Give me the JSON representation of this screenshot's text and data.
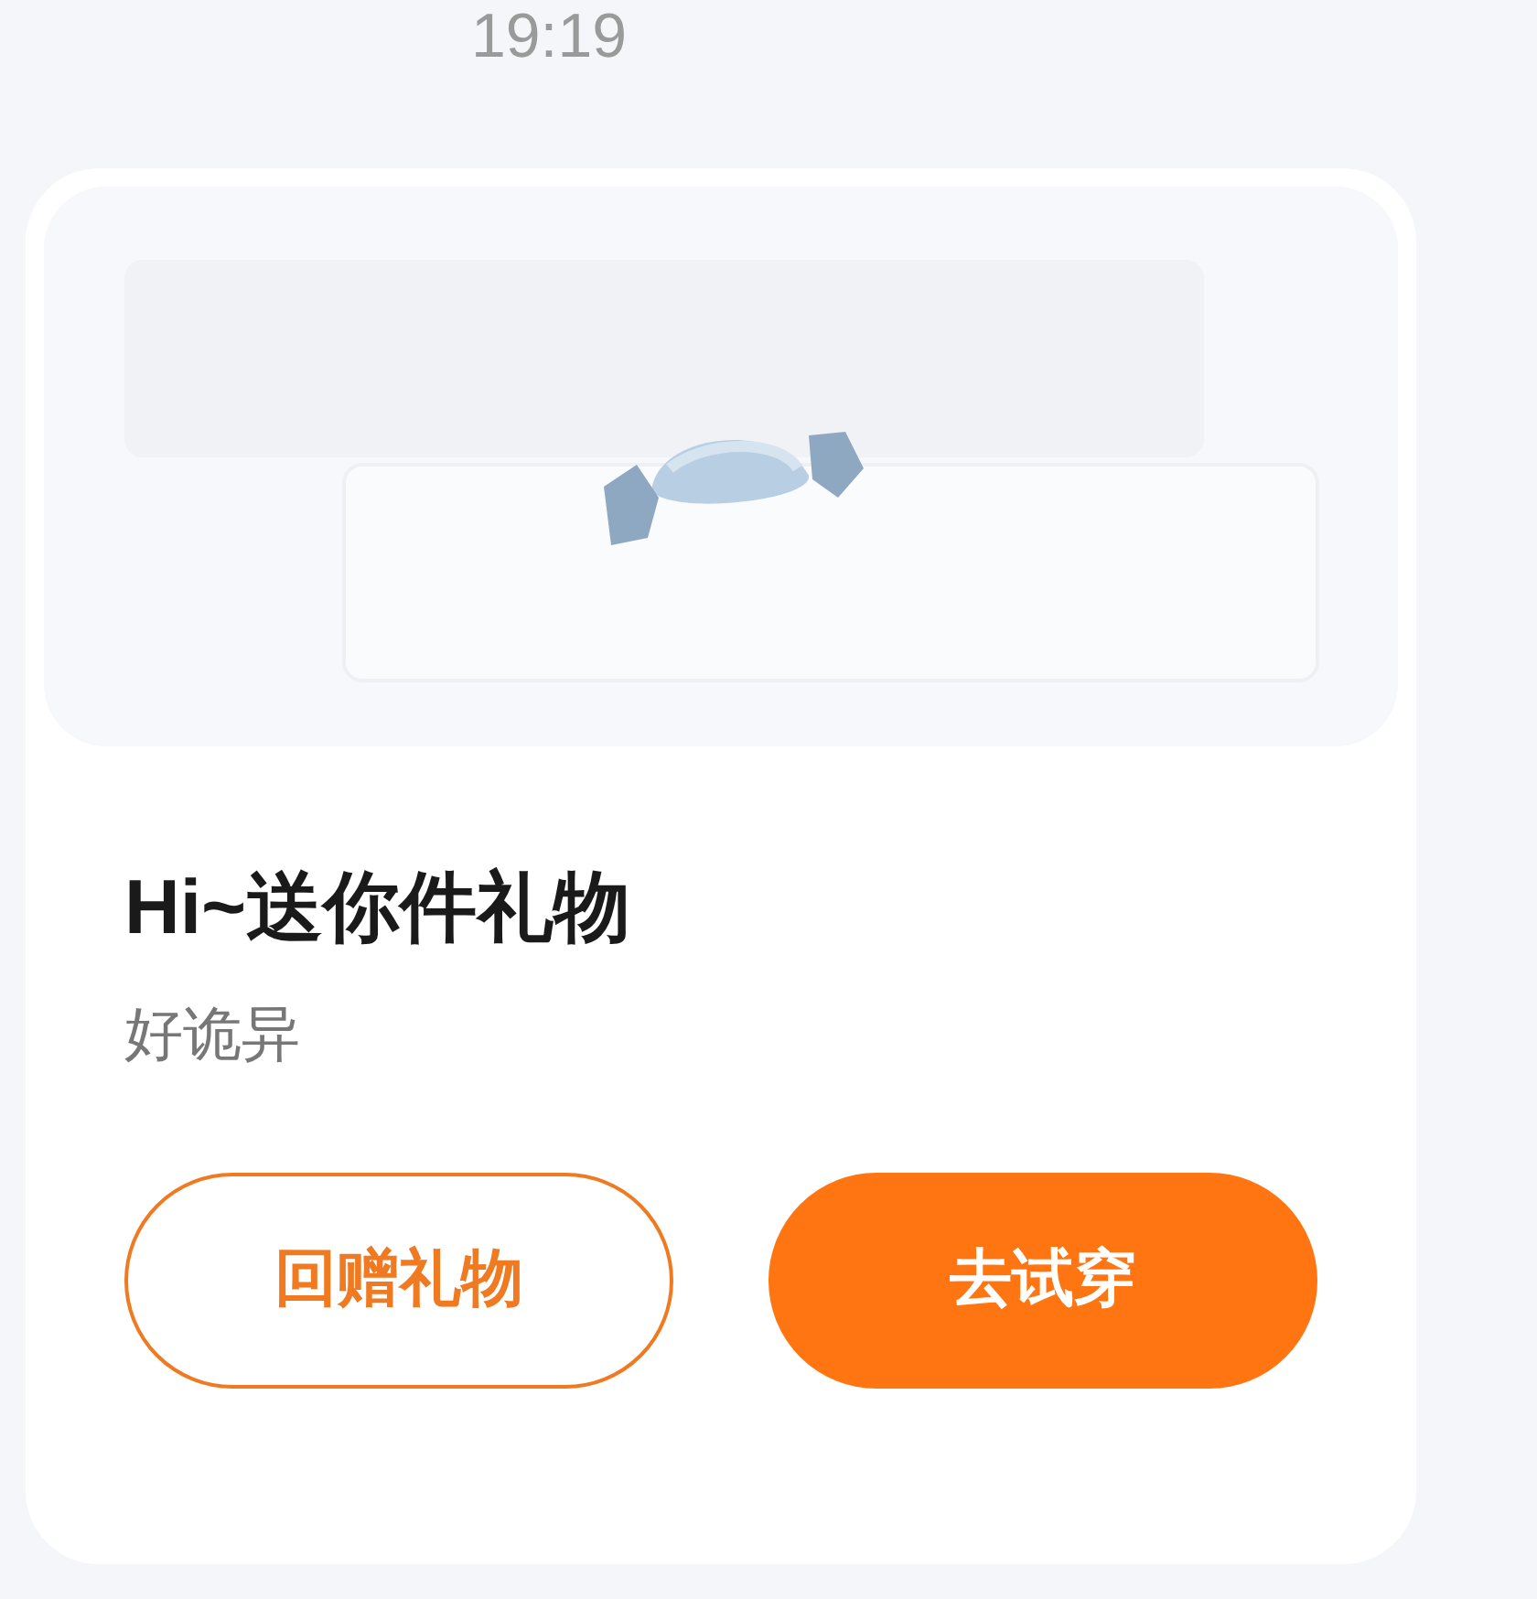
{
  "time": "19:19",
  "card": {
    "title": "Hi~送你件礼物",
    "subtitle": "好诡异",
    "buttons": [
      {
        "label": "回赠礼物",
        "kind": "outline"
      },
      {
        "label": "去试穿",
        "kind": "filled"
      }
    ]
  }
}
